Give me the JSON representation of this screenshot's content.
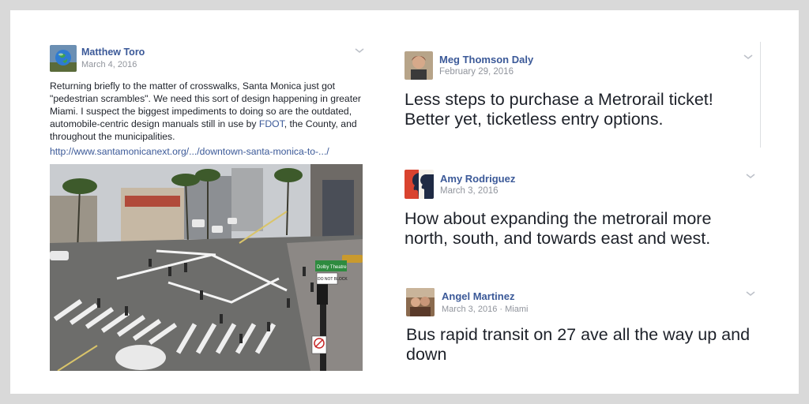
{
  "posts": [
    {
      "author": "Matthew Toro",
      "date": "March 4, 2016",
      "text_before": "Returning briefly to the matter of crosswalks, Santa Monica just got \"pedestrian scrambles\". We need this sort of design happening in greater Miami. I suspect the biggest impediments to doing so are the outdated, automobile-centric design manuals still in use by ",
      "text_link": "FDOT",
      "text_after": ", the County, and throughout the municipalities.",
      "url": "http://www.santamonicanext.org/.../downtown-santa-monica-to-.../",
      "photo_signs": {
        "green": "Dolby Theatre",
        "white": "DO NOT BLOCK"
      }
    },
    {
      "author": "Meg Thomson Daly",
      "date": "February 29, 2016",
      "text": "Less steps to purchase a Metrorail ticket! Better yet, ticketless entry options."
    },
    {
      "author": "Amy Rodriguez",
      "date": "March 3, 2016",
      "text": "How about expanding the metrorail more north, south, and towards east and west."
    },
    {
      "author": "Angel Martinez",
      "date": "March 3, 2016 · Miami",
      "text": "Bus rapid transit on 27 ave all the way up and down"
    }
  ],
  "colors": {
    "link": "#3b5998",
    "meta": "#90949c",
    "text": "#1d2129",
    "background": "#d9d9d9"
  }
}
